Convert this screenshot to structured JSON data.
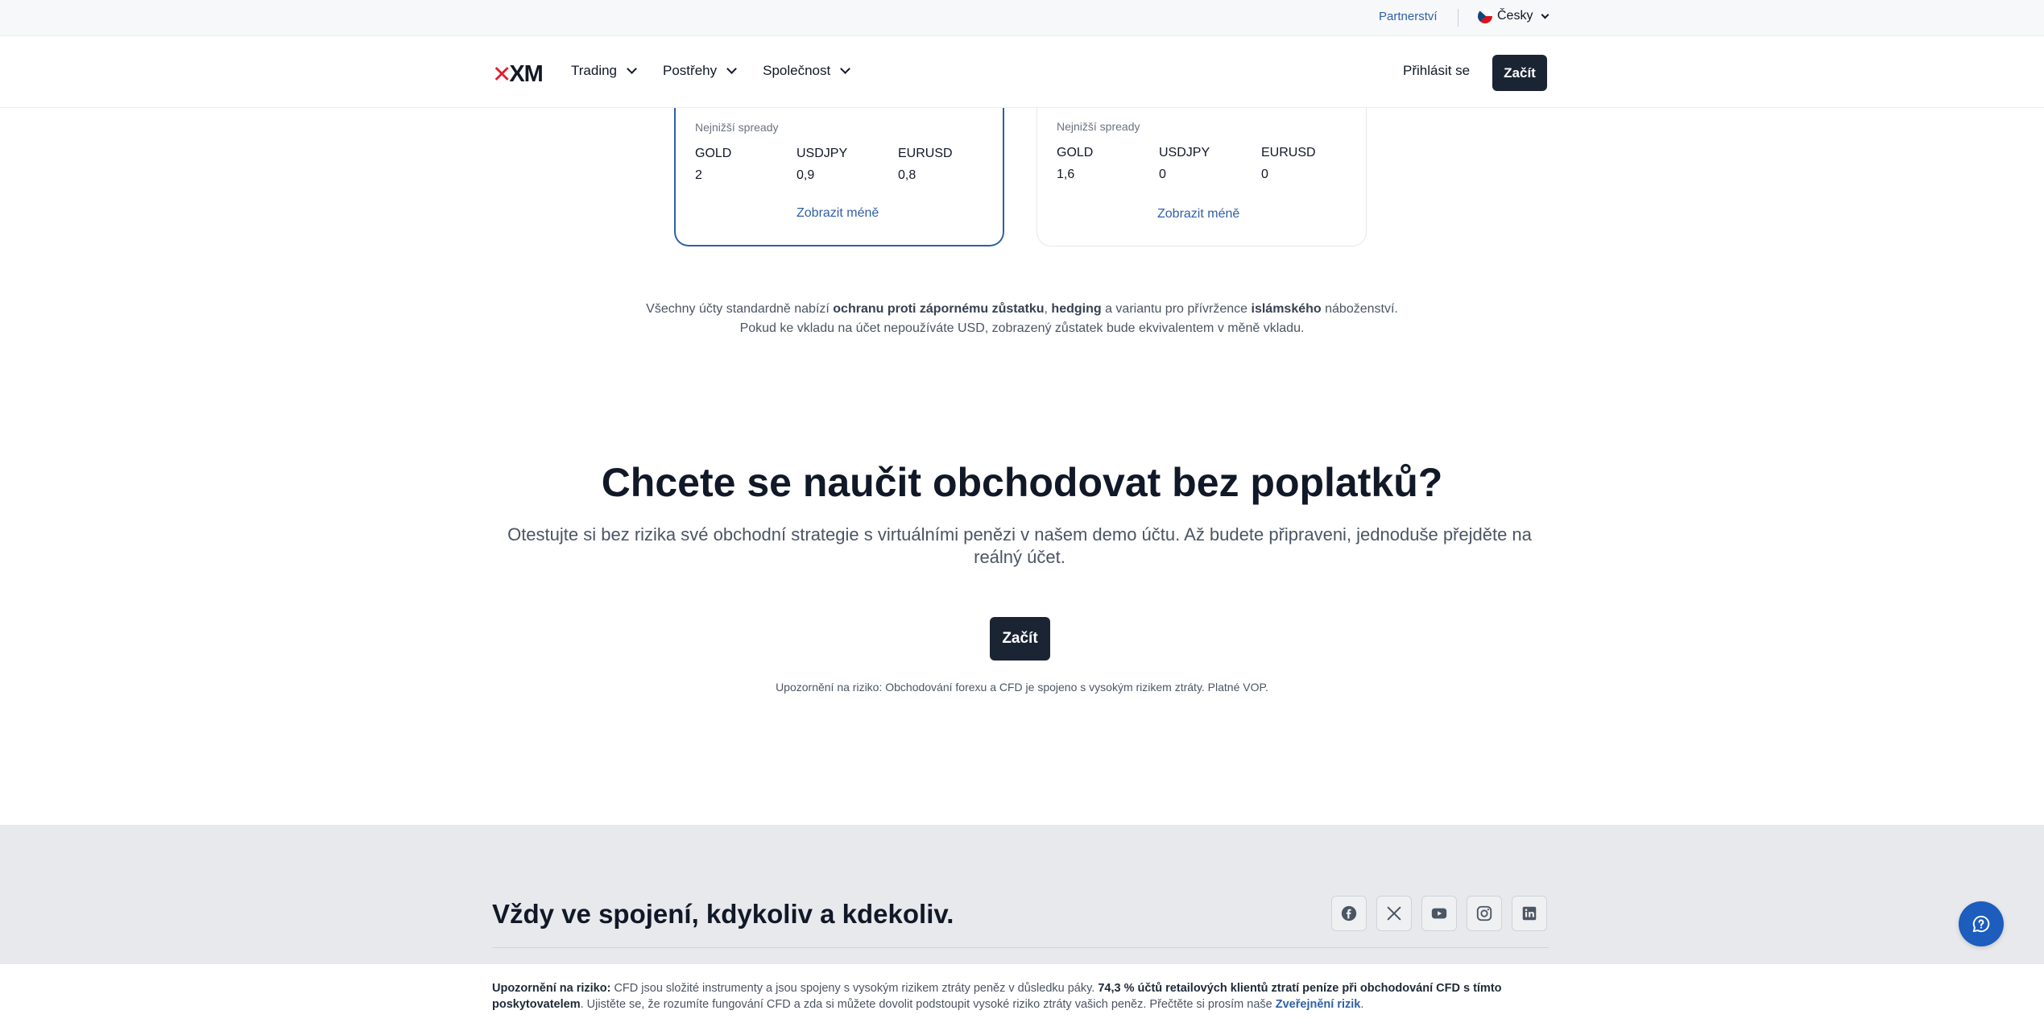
{
  "topbar": {
    "partner": "Partnerství",
    "language": "Česky"
  },
  "nav": {
    "logo": "XM",
    "menu": [
      "Trading",
      "Postřehy",
      "Společnost"
    ],
    "login": "Přihlásit se",
    "start": "Začít"
  },
  "cards": [
    {
      "label": "Nejnižší spready",
      "cols": [
        {
          "name": "GOLD",
          "value": "2"
        },
        {
          "name": "USDJPY",
          "value": "0,9"
        },
        {
          "name": "EURUSD",
          "value": "0,8"
        }
      ],
      "toggle": "Zobrazit méně"
    },
    {
      "label": "Nejnižší spready",
      "cols": [
        {
          "name": "GOLD",
          "value": "1,6"
        },
        {
          "name": "USDJPY",
          "value": "0"
        },
        {
          "name": "EURUSD",
          "value": "0"
        }
      ],
      "toggle": "Zobrazit méně"
    }
  ],
  "note": {
    "l1_a": "Všechny účty standardně nabízí ",
    "l1_b": "ochranu proti zápornému zůstatku",
    "l1_c": ", ",
    "l1_d": "hedging",
    "l1_e": " a variantu pro přívržence ",
    "l1_f": "islámského",
    "l1_g": " náboženství.",
    "l2": "Pokud ke vkladu na účet nepoužíváte USD, zobrazený zůstatek bude ekvivalentem v měně vkladu."
  },
  "cta": {
    "title": "Chcete se naučit obchodovat bez poplatků?",
    "subtitle": "Otestujte si bez rizika své obchodní strategie s virtuálními penězi v našem demo účtu. Až budete připraveni, jednoduše přejděte na reálný účet.",
    "button": "Začít",
    "risk": "Upozornění na riziko: Obchodování forexu a CFD je spojeno s vysokým rizikem ztráty. Platné VOP."
  },
  "footer": {
    "title": "Vždy ve spojení, kdykoliv a kdekoliv.",
    "socials": [
      "facebook-icon",
      "x-icon",
      "youtube-icon",
      "instagram-icon",
      "linkedin-icon"
    ]
  },
  "riskbar": {
    "label": "Upozornění na riziko:",
    "text1": " CFD jsou složité instrumenty a jsou spojeny s vysokým rizikem ztráty peněz v důsledku páky. ",
    "bold": "74,3 % účtů retailových klientů ztratí peníze při obchodování CFD s tímto poskytovatelem",
    "text2": ". Ujistěte se, že rozumíte fungování CFD a zda si můžete dovolit podstoupit vysoké riziko ztráty vašich peněz. Přečtěte si prosím naše ",
    "link": "Zveřejnění rizik",
    "end": "."
  },
  "colors": {
    "accent": "#2f5fa8",
    "dark": "#1b2433",
    "chat": "#1c5dbd",
    "brand_red": "#e01e2b"
  }
}
